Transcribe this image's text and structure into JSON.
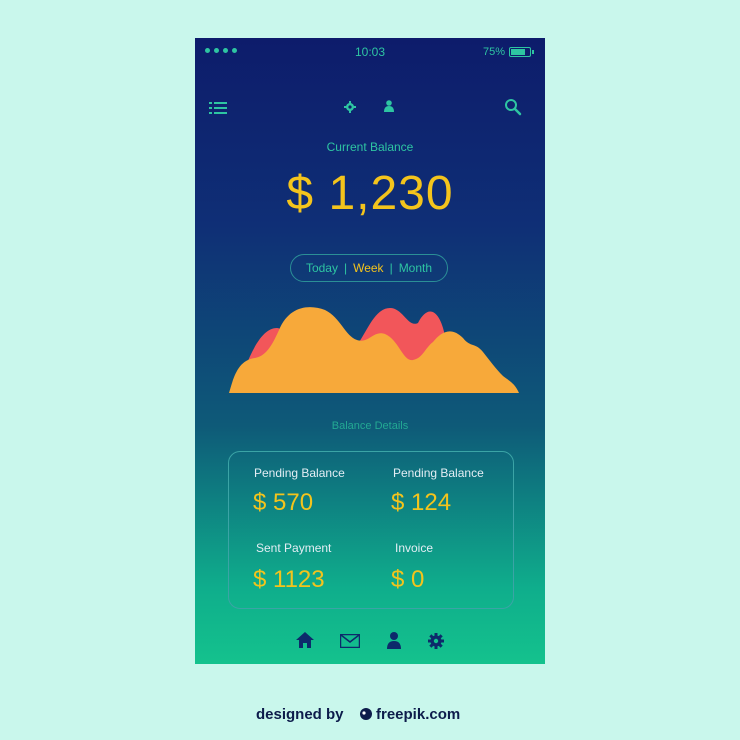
{
  "status_bar": {
    "time": "10:03",
    "battery_percent": "75%"
  },
  "header": {
    "icons": [
      "menu-icon",
      "gear-icon",
      "user-icon",
      "search-icon"
    ]
  },
  "balance": {
    "label": "Current Balance",
    "amount": "$ 1,230"
  },
  "period_toggle": {
    "options": [
      "Today",
      "Week",
      "Month"
    ],
    "selected": "Week"
  },
  "details": {
    "title": "Balance Details",
    "items": [
      {
        "label": "Pending Balance",
        "value": "$ 570"
      },
      {
        "label": "Pending Balance",
        "value": "$ 124"
      },
      {
        "label": "Sent Payment",
        "value": "$ 1123"
      },
      {
        "label": "Invoice",
        "value": "$ 0"
      }
    ]
  },
  "bottom_nav": {
    "icons": [
      "home-icon",
      "mail-icon",
      "user-icon",
      "gear-icon"
    ]
  },
  "colors": {
    "accent_yellow": "#f4c41c",
    "accent_teal": "#2ec5a2",
    "chart_orange": "#f7a93a",
    "chart_red": "#f2565a",
    "background": "#c9f7ec"
  },
  "watermark": "designed by freepik.com"
}
